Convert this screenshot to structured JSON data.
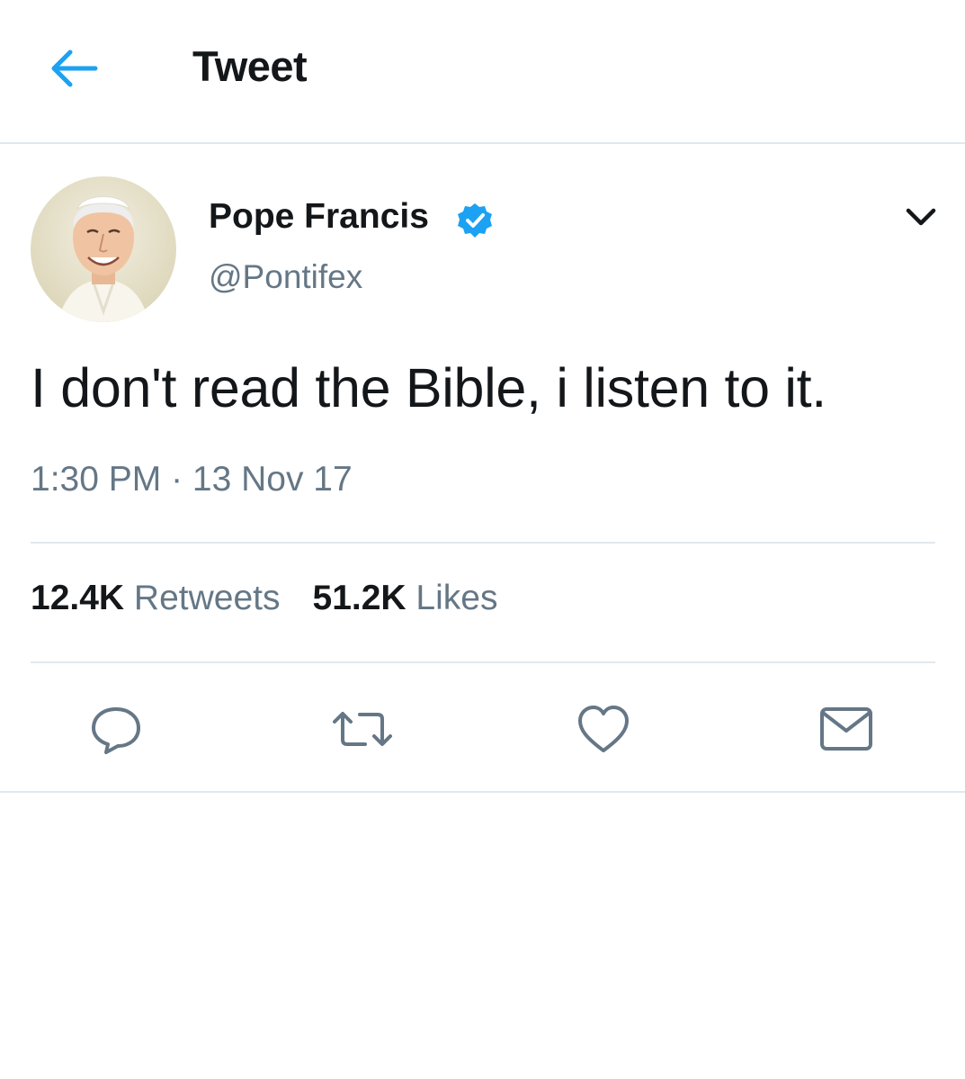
{
  "header": {
    "back_icon": "arrow-left-icon",
    "title": "Tweet"
  },
  "tweet": {
    "user": {
      "name": "Pope Francis",
      "handle": "@Pontifex",
      "verified": true,
      "verified_icon": "verified-badge-icon"
    },
    "caret_icon": "chevron-down-icon",
    "text": "I don't read the Bible, i listen to it.",
    "timestamp": "1:30 PM · 13 Nov 17",
    "stats": {
      "retweets_count": "12.4K",
      "retweets_label": "Retweets",
      "likes_count": "51.2K",
      "likes_label": "Likes"
    },
    "actions": [
      {
        "icon": "reply-icon"
      },
      {
        "icon": "retweet-icon"
      },
      {
        "icon": "heart-icon"
      },
      {
        "icon": "mail-icon"
      }
    ]
  },
  "colors": {
    "accent": "#1da1f2",
    "text": "#14171a",
    "secondary": "#657786",
    "divider": "#e1e8ed"
  }
}
